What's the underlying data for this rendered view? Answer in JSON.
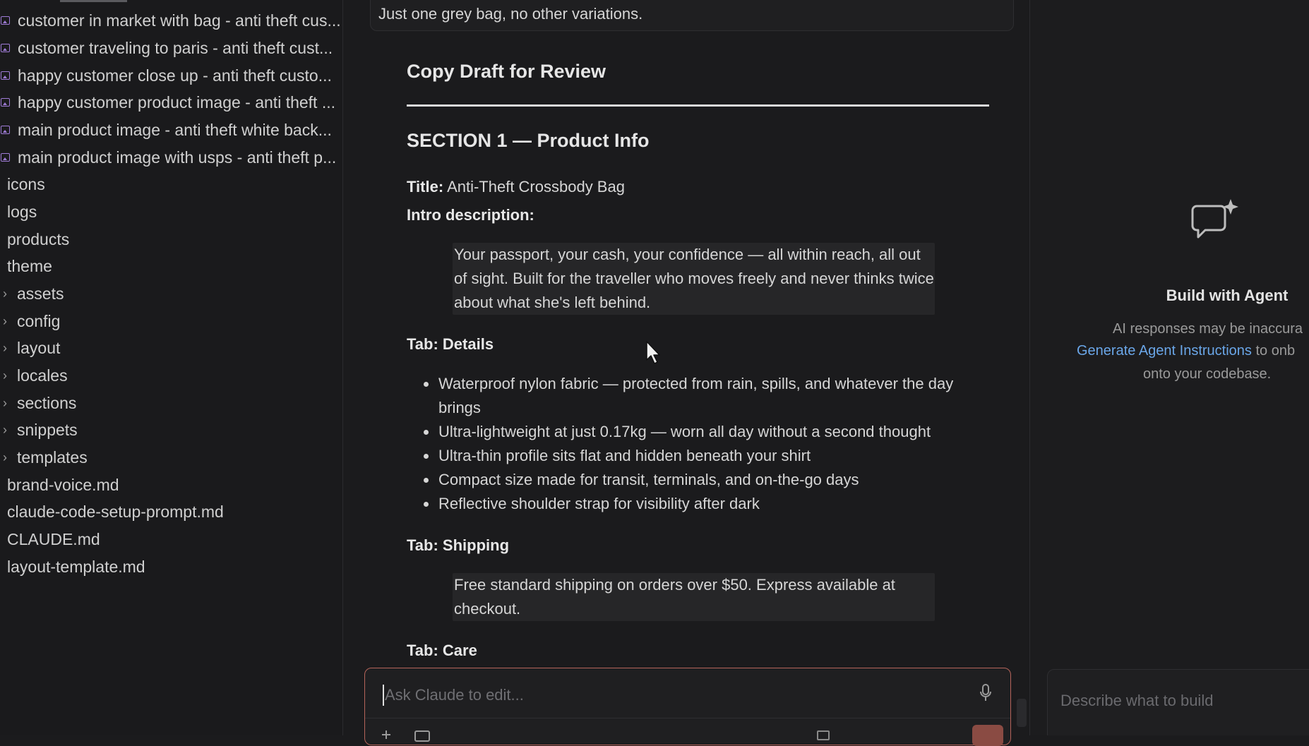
{
  "sidebar": {
    "image_files": [
      "customer in market with bag - anti theft cus...",
      "customer traveling to paris - anti theft cust...",
      "happy customer close up - anti theft custo...",
      "happy customer product image - anti theft ...",
      "main product image - anti theft white back...",
      "main product image with usps - anti theft p..."
    ],
    "plain_folders": [
      "icons",
      "logs",
      "products",
      "theme"
    ],
    "collapsed_folders": [
      "assets",
      "config",
      "layout",
      "locales",
      "sections",
      "snippets",
      "templates"
    ],
    "files": [
      "brand-voice.md",
      "claude-code-setup-prompt.md",
      "CLAUDE.md",
      "layout-template.md"
    ]
  },
  "main": {
    "previous_message": "Just one grey bag, no other variations.",
    "draft_heading": "Copy Draft for Review",
    "section_heading": "SECTION 1 — Product Info",
    "title_label": "Title:",
    "title_value": "Anti-Theft Crossbody Bag",
    "intro_label": "Intro description:",
    "intro_text": "Your passport, your cash, your confidence — all within reach, all out of sight. Built for the traveller who moves freely and never thinks twice about what she's left behind.",
    "details_label": "Tab: Details",
    "details_bullets": [
      "Waterproof nylon fabric — protected from rain, spills, and whatever the day brings",
      "Ultra-lightweight at just 0.17kg — worn all day without a second thought",
      "Ultra-thin profile sits flat and hidden beneath your shirt",
      "Compact size made for transit, terminals, and on-the-go days",
      "Reflective shoulder strap for visibility after dark"
    ],
    "shipping_label": "Tab: Shipping",
    "shipping_text": "Free standard shipping on orders over $50. Express available at checkout.",
    "care_label": "Tab: Care"
  },
  "chat_input": {
    "placeholder": "Ask Claude to edit..."
  },
  "right_panel": {
    "title": "Build with Agent",
    "line1": "AI responses may be inaccura",
    "link_text": "Generate Agent Instructions",
    "line2_rest": " to onb",
    "line3": "onto your codebase.",
    "build_placeholder": "Describe what to build"
  },
  "colors": {
    "background": "#1b1b1d",
    "accent_border": "#b5645a",
    "link": "#6aa6e8",
    "image_icon": "#9f7bd6"
  }
}
